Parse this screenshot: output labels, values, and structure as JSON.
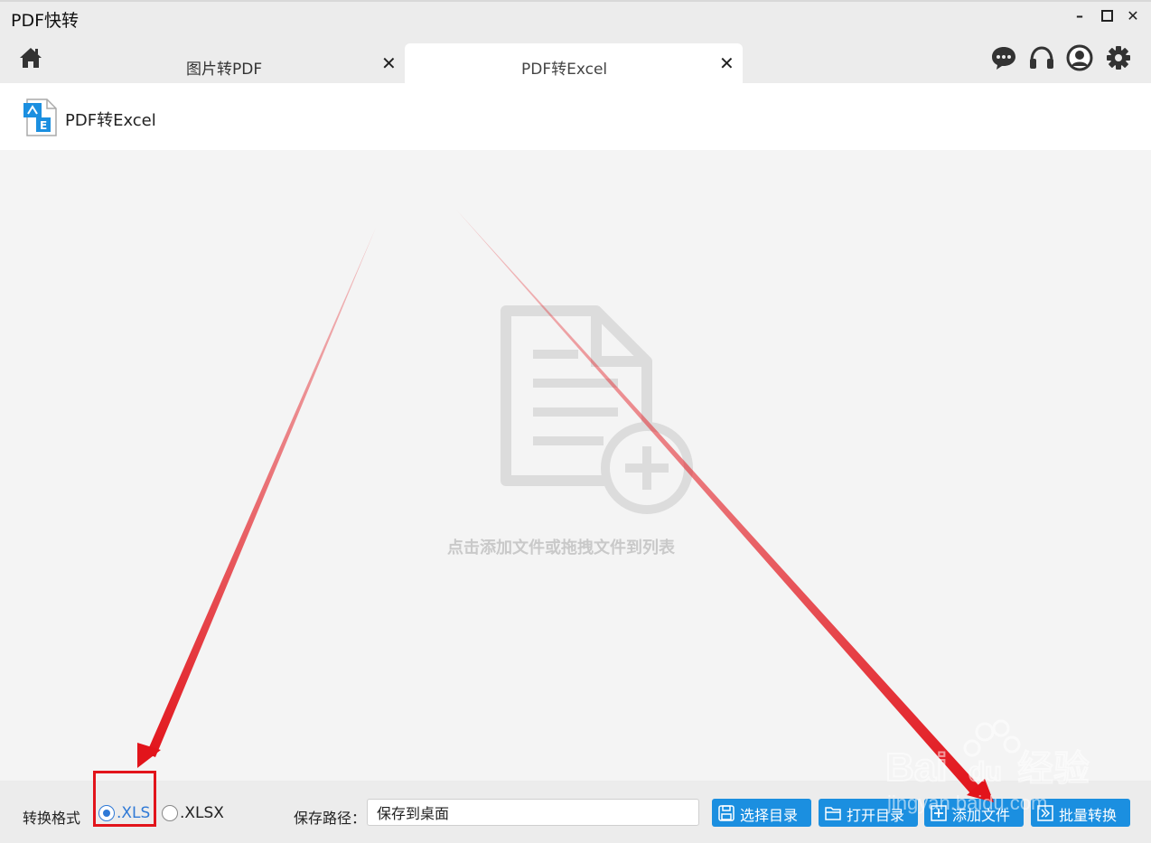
{
  "app": {
    "title": "PDF快转"
  },
  "window_controls": {
    "minimize": "–",
    "close": "✕"
  },
  "tabs": [
    {
      "label": "图片转PDF",
      "close": "✕",
      "active": false
    },
    {
      "label": "PDF转Excel",
      "close": "✕",
      "active": true
    }
  ],
  "toolbar_icons": [
    "chat-icon",
    "headset-icon",
    "user-icon",
    "gear-icon"
  ],
  "page": {
    "title": "PDF转Excel",
    "icon": "pdf-to-excel-icon"
  },
  "drop_area": {
    "hint": "点击添加文件或拖拽文件到列表"
  },
  "bottom": {
    "format_label": "转换格式",
    "formats": [
      {
        "label": ".XLS",
        "selected": true
      },
      {
        "label": ".XLSX",
        "selected": false
      }
    ],
    "path_label": "保存路径：",
    "path_value": "保存到桌面",
    "buttons": [
      {
        "label": "选择目录",
        "icon": "save-icon"
      },
      {
        "label": "打开目录",
        "icon": "folder-icon"
      },
      {
        "label": "添加文件",
        "icon": "add-file-icon"
      },
      {
        "label": "批量转换",
        "icon": "batch-convert-icon"
      }
    ]
  },
  "watermark": {
    "brand": "Bai",
    "brand2": "du",
    "cn": "经验",
    "url": "jingyan.baidu.com"
  },
  "colors": {
    "accent": "#1b8fe0",
    "annotation": "#e2141b",
    "radio": "#2f79d6"
  }
}
